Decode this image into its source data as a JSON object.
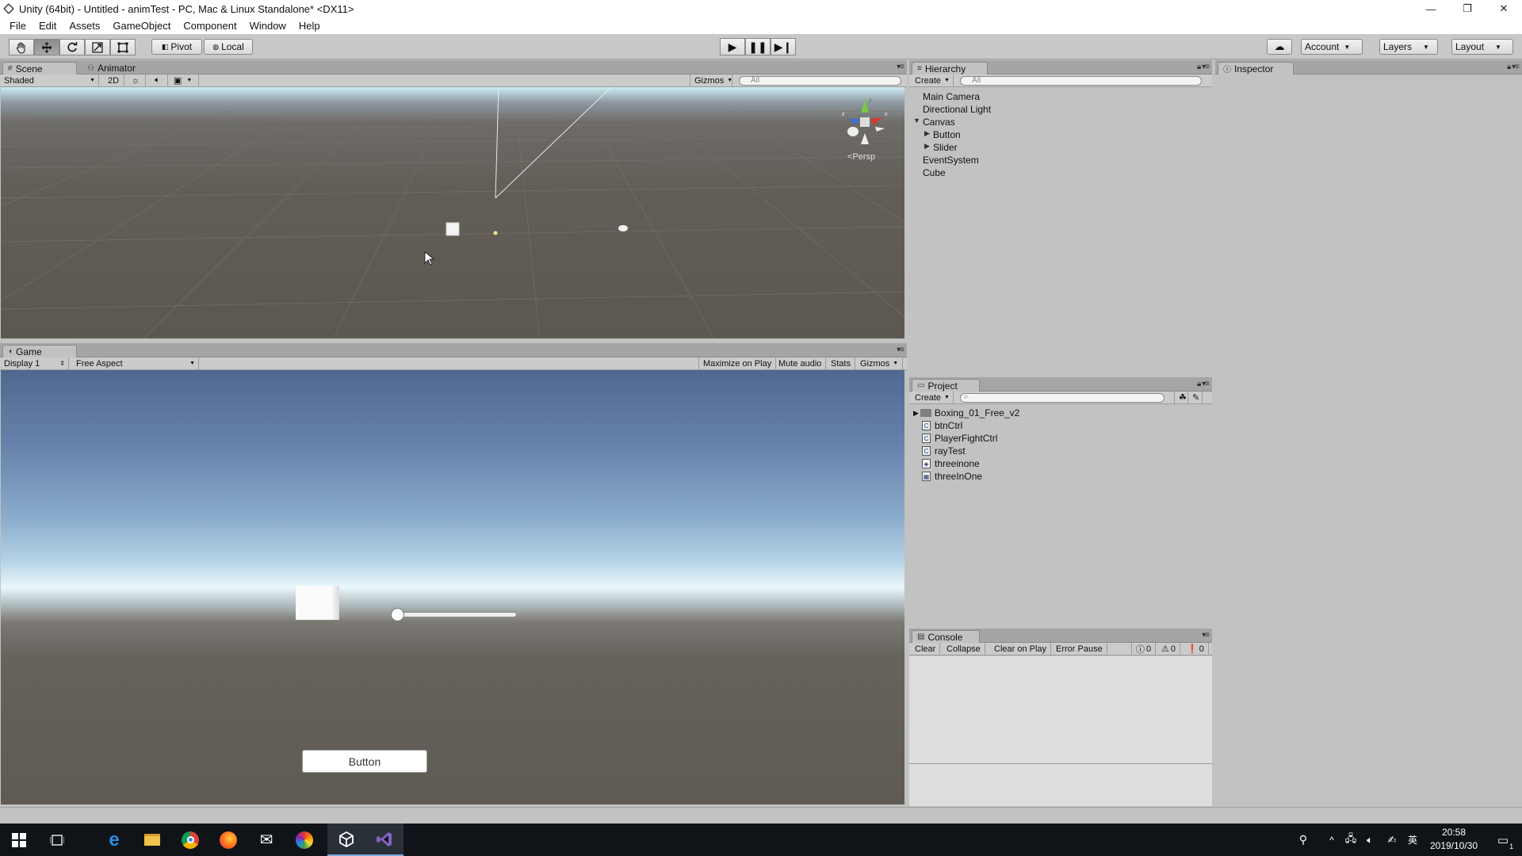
{
  "window": {
    "title": "Unity (64bit) - Untitled - animTest - PC, Mac & Linux Standalone* <DX11>",
    "controls": [
      "—",
      "❐",
      "✕"
    ]
  },
  "menubar": [
    "File",
    "Edit",
    "Assets",
    "GameObject",
    "Component",
    "Window",
    "Help"
  ],
  "toolbar": {
    "pivot": "Pivot",
    "local": "Local",
    "account": "Account",
    "layers": "Layers",
    "layout": "Layout"
  },
  "scene_panel": {
    "tabs": [
      "Scene",
      "Animator"
    ],
    "shading": "Shaded",
    "mode_2d": "2D",
    "gizmos": "Gizmos",
    "search_placeholder": "All",
    "persp_label": "Persp",
    "gizmo_axes": [
      "y",
      "z",
      "x"
    ]
  },
  "game_panel": {
    "tab": "Game",
    "display": "Display 1",
    "aspect": "Free Aspect",
    "options": [
      "Maximize on Play",
      "Mute audio",
      "Stats",
      "Gizmos"
    ],
    "button_label": "Button",
    "slider_value": 0.0
  },
  "hierarchy_panel": {
    "tab": "Hierarchy",
    "create": "Create",
    "search_placeholder": "All",
    "items": [
      "Main Camera",
      "Directional Light",
      "Canvas",
      "Button",
      "Slider",
      "EventSystem",
      "Cube"
    ]
  },
  "inspector_panel": {
    "tab": "Inspector"
  },
  "project_panel": {
    "tab": "Project",
    "create": "Create",
    "items": [
      "Boxing_01_Free_v2",
      "btnCtrl",
      "PlayerFightCtrl",
      "rayTest",
      "threeinone",
      "threeInOne"
    ]
  },
  "console_panel": {
    "tab": "Console",
    "buttons": [
      "Clear",
      "Collapse",
      "Clear on Play",
      "Error Pause"
    ],
    "counts": [
      "0",
      "0",
      "0"
    ]
  },
  "taskbar": {
    "time": "20:58",
    "date": "2019/10/30",
    "ime": "英",
    "notification_count": "1"
  }
}
